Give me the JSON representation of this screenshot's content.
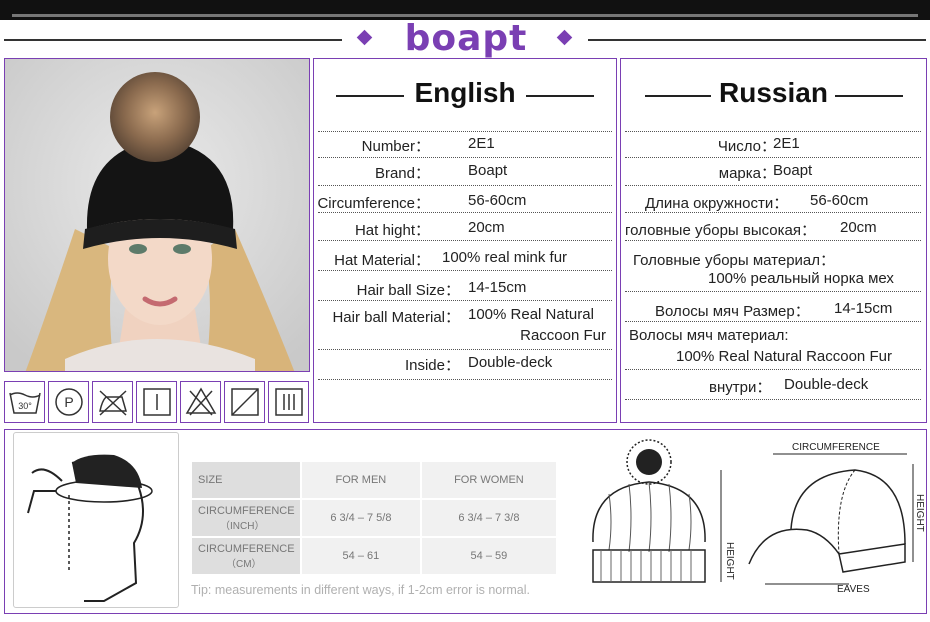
{
  "brand": {
    "logo_text": "boapt",
    "accent_color": "#7a3fb3"
  },
  "care_icons": [
    {
      "icon": "wash-30-icon",
      "text": "30°"
    },
    {
      "icon": "dry-clean-p-icon",
      "text": "P"
    },
    {
      "icon": "no-iron-icon"
    },
    {
      "icon": "line-dry-icon"
    },
    {
      "icon": "no-bleach-icon"
    },
    {
      "icon": "drip-dry-icon"
    },
    {
      "icon": "tumble-shade-icon"
    }
  ],
  "english": {
    "title": "English",
    "rows": [
      {
        "label": "Number：",
        "value": "2E1"
      },
      {
        "label": "Brand：",
        "value": "Boapt"
      },
      {
        "label": "Circumference：",
        "value": "56-60cm"
      },
      {
        "label": "Hat hight：",
        "value": "20cm"
      },
      {
        "label": "Hat Material：",
        "value": "100% real mink fur"
      },
      {
        "label": "Hair ball Size：",
        "value": "14-15cm"
      },
      {
        "label": "Hair ball Material：",
        "value": "100% Real Natural",
        "value2": "Raccoon Fur"
      },
      {
        "label": "Inside：",
        "value": "Double-deck"
      }
    ]
  },
  "russian": {
    "title": "Russian",
    "rows": [
      {
        "label": "Число：",
        "value": "2E1"
      },
      {
        "label": "марка：",
        "value": "Boapt"
      },
      {
        "label": "Длина окружности：",
        "value": "56-60cm"
      },
      {
        "label": "головные уборы высокая：",
        "value": "20cm"
      },
      {
        "label": "Головные уборы материал：",
        "value": "100% реальный норка мех"
      },
      {
        "label": "Волосы мяч Размер：",
        "value": "14-15cm"
      },
      {
        "label": "Волосы мяч материал:",
        "value": "100% Real Natural Raccoon Fur"
      },
      {
        "label": "внутри：",
        "value": "Double-deck"
      }
    ]
  },
  "size_table": {
    "headers": [
      "SIZE",
      "FOR MEN",
      "FOR WOMEN"
    ],
    "rows": [
      {
        "label": "CIRCUMFERENCE",
        "unit": "（INCH）",
        "men": "6 3/4 – 7 5/8",
        "women": "6 3/4 – 7 3/8"
      },
      {
        "label": "CIRCUMFERENCE",
        "unit": "（CM）",
        "men": "54 – 61",
        "women": "54 – 59"
      }
    ],
    "tip": "Tip: measurements in different ways, if 1-2cm error is normal."
  },
  "diagram_labels": {
    "beanie_height": "HEIGHT",
    "cap_circumference": "CIRCUMFERENCE",
    "cap_height": "HEIGHT",
    "cap_eaves": "EAVES"
  }
}
